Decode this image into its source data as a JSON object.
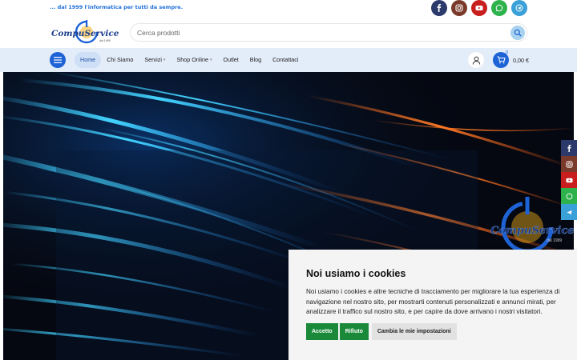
{
  "topbar": {
    "tagline": "... dal 1999 l'informatica per tutti da sempre.",
    "social": [
      {
        "icon": "facebook-icon",
        "color": "#2b3a6b"
      },
      {
        "icon": "instagram-icon",
        "color": "#7a3a2a"
      },
      {
        "icon": "youtube-icon",
        "color": "#c81e1e"
      },
      {
        "icon": "whatsapp-icon",
        "color": "#2db24c"
      },
      {
        "icon": "telegram-icon",
        "color": "#3aa0d8"
      }
    ]
  },
  "header": {
    "logo_text": "CompuService",
    "logo_sub": "dal 1999",
    "search_placeholder": "Cerca prodotti"
  },
  "nav": {
    "items": [
      {
        "label": "Home",
        "active": true
      },
      {
        "label": "Chi Siamo"
      },
      {
        "label": "Servizi",
        "dropdown": true
      },
      {
        "label": "Shop Online",
        "dropdown": true
      },
      {
        "label": "Outlet"
      },
      {
        "label": "Blog"
      },
      {
        "label": "Contattaci"
      }
    ],
    "cart_count": "0",
    "cart_total": "0,00 €"
  },
  "hero": {
    "logo_text": "CompuService",
    "logo_sub": "dal 1999"
  },
  "side_social": [
    {
      "icon": "facebook-icon",
      "color": "#2b3a6b"
    },
    {
      "icon": "instagram-icon",
      "color": "#7a3a2a"
    },
    {
      "icon": "youtube-icon",
      "color": "#c81e1e"
    },
    {
      "icon": "whatsapp-icon",
      "color": "#2db24c"
    },
    {
      "icon": "telegram-icon",
      "color": "#3aa0d8"
    }
  ],
  "cookie": {
    "title": "Noi usiamo i cookies",
    "text": "Noi usiamo i cookies e altre tecniche di tracciamento per migliorare la tua esperienza di navigazione nel nostro sito, per mostrarti contenuti personalizzati e annunci mirati, per analizzare il traffico sul nostro sito, e per capire da dove arrivano i nostri visitatori.",
    "accept": "Accetto",
    "reject": "Rifiuto",
    "settings": "Cambia le mie impostazioni"
  },
  "colors": {
    "accent": "#1e63d6",
    "nav_bg": "#e3ecf9",
    "cookie_green": "#1a8a3a"
  }
}
